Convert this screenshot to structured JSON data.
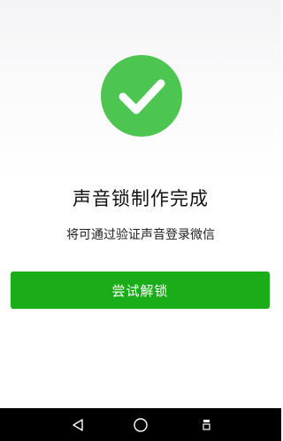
{
  "completion": {
    "icon": "check-icon",
    "title": "声音锁制作完成",
    "subtitle": "将可通过验证声音登录微信",
    "primary_button": "尝试解锁"
  },
  "navbar": {
    "back_icon": "back-triangle-icon",
    "home_icon": "home-circle-icon",
    "recent_icon": "recent-apps-icon"
  },
  "colors": {
    "check_green": "#4cc551",
    "button_green": "#1aad19"
  }
}
